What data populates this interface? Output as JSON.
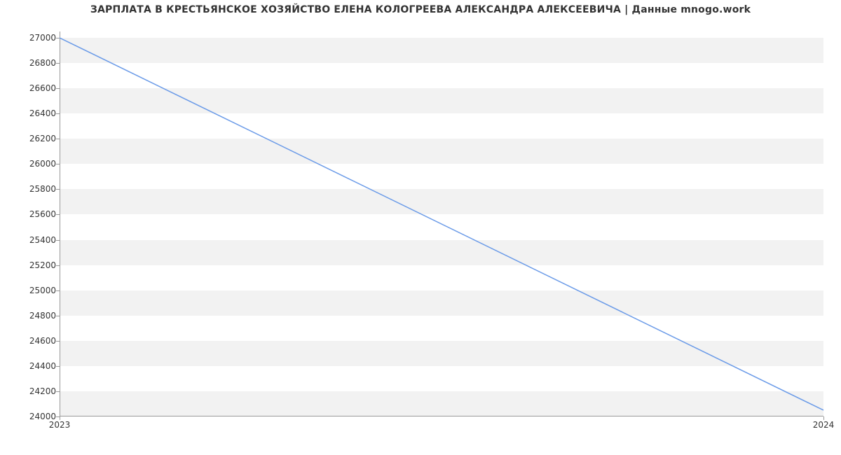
{
  "chart_data": {
    "type": "line",
    "title": "ЗАРПЛАТА В КРЕСТЬЯНСКОЕ ХОЗЯЙСТВО ЕЛЕНА КОЛОГРЕЕВА АЛЕКСАНДРА АЛЕКСЕЕВИЧА | Данные mnogo.work",
    "xlabel": "",
    "ylabel": "",
    "x_categories": [
      "2023",
      "2024"
    ],
    "series": [
      {
        "name": "salary",
        "x": [
          "2023",
          "2024"
        ],
        "y": [
          27000,
          24050
        ]
      }
    ],
    "ylim": [
      24000,
      27050
    ],
    "y_ticks": [
      24000,
      24200,
      24400,
      24600,
      24800,
      25000,
      25200,
      25400,
      25600,
      25800,
      26000,
      26200,
      26400,
      26600,
      26800,
      27000
    ],
    "x_ticks": [
      "2023",
      "2024"
    ],
    "grid": "banded",
    "line_color": "#6b9be8"
  }
}
